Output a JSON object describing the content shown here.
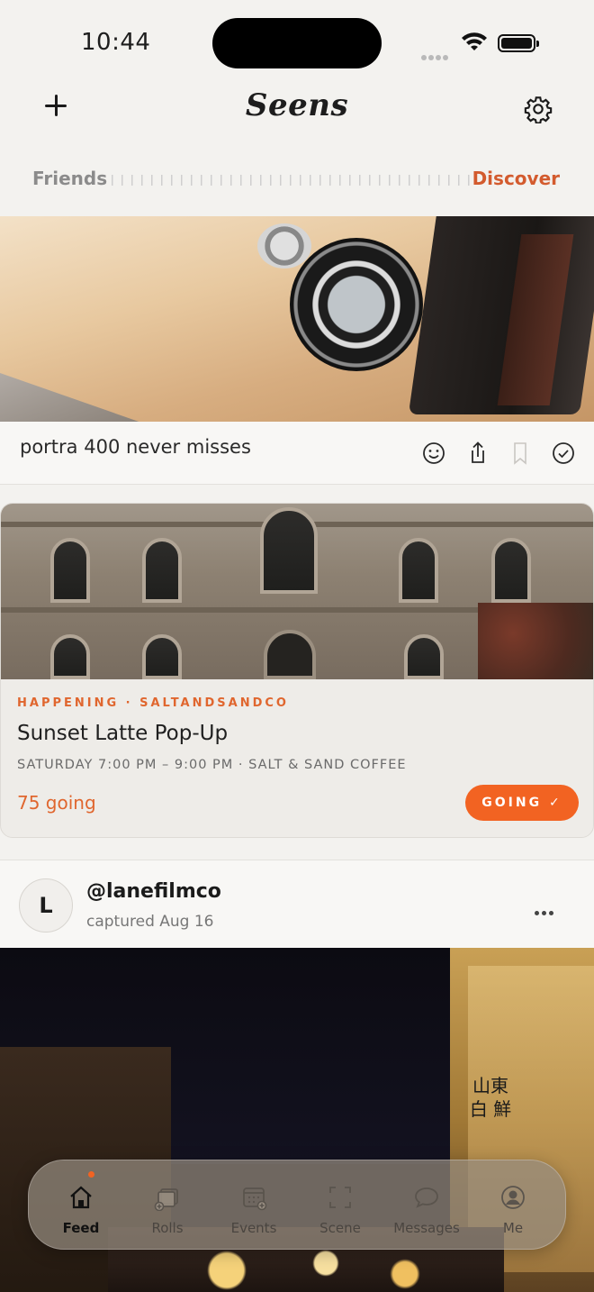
{
  "status_bar": {
    "time": "10:44"
  },
  "header": {
    "title": "Seens"
  },
  "segment": {
    "left": "Friends",
    "right": "Discover",
    "active": "Discover"
  },
  "post1": {
    "caption": "portra 400 never misses"
  },
  "event": {
    "meta": "HAPPENING · SALTANDSANDCO",
    "title": "Sunset Latte Pop-Up",
    "when": "SATURDAY 7:00 PM – 9:00 PM · SALT & SAND COFFEE",
    "going_count": "75 going",
    "going_button": "GOING ✓"
  },
  "post2": {
    "avatar_letter": "L",
    "handle": "@lanefilmco",
    "captured": "captured Aug 16",
    "sign_text": "山東 白 鮮"
  },
  "tabs": [
    {
      "label": "Feed",
      "icon": "house-icon",
      "active": true
    },
    {
      "label": "Rolls",
      "icon": "rolls-icon",
      "active": false
    },
    {
      "label": "Events",
      "icon": "calendar-icon",
      "active": false
    },
    {
      "label": "Scene",
      "icon": "scan-icon",
      "active": false
    },
    {
      "label": "Messages",
      "icon": "chat-bubble-icon",
      "active": false
    },
    {
      "label": "Me",
      "icon": "person-icon",
      "active": false
    }
  ],
  "colors": {
    "accent": "#f26322",
    "accent_text": "#e0662e",
    "discover": "#d35b2e",
    "background": "#f3f2ef"
  }
}
